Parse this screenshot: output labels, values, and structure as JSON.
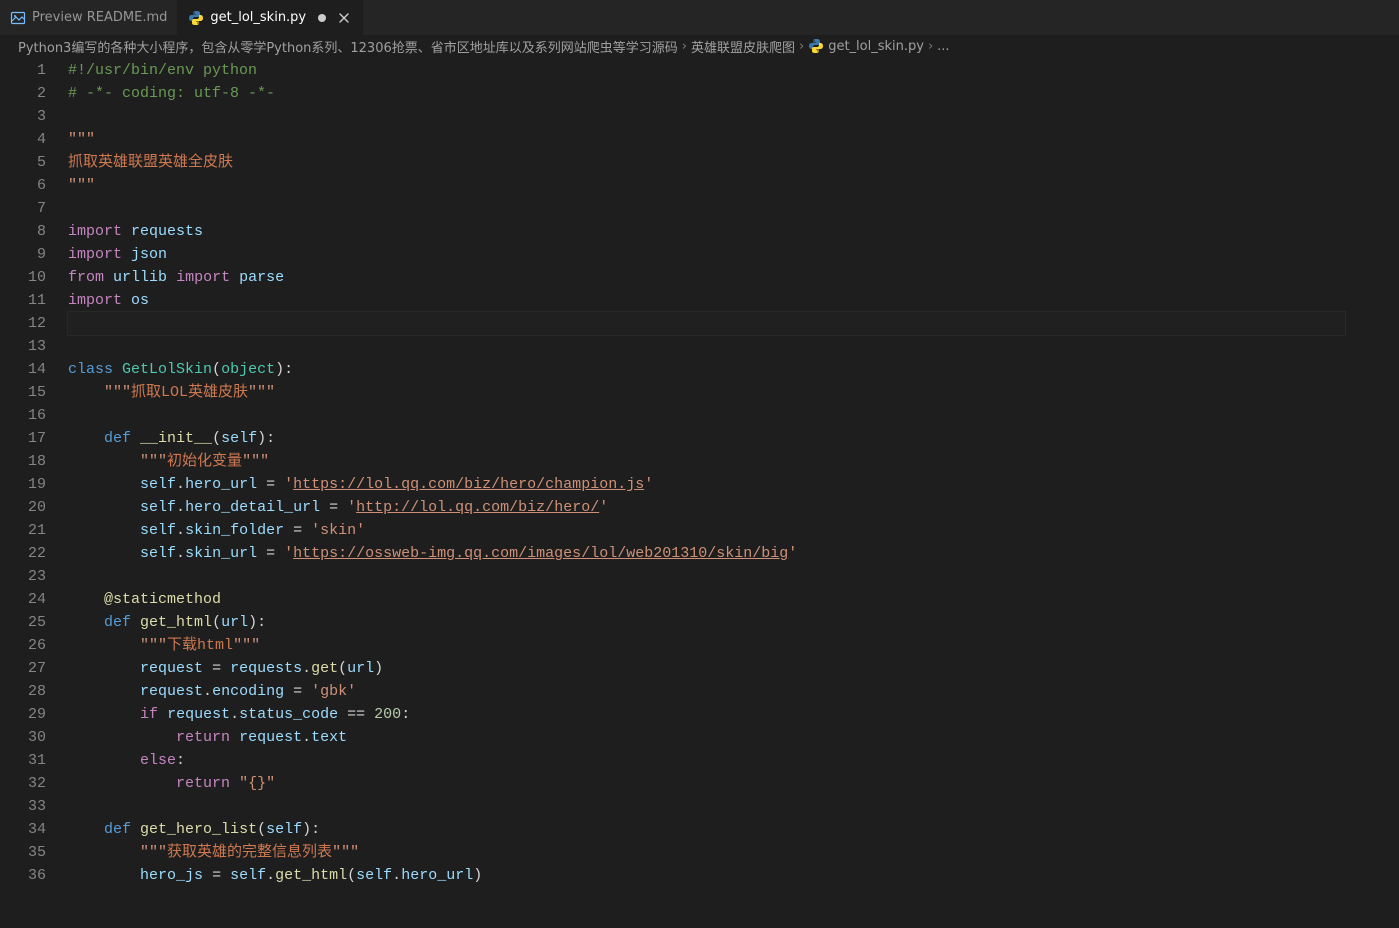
{
  "tabs": [
    {
      "label": "Preview README.md",
      "active": false,
      "dirty": false,
      "icon": "preview"
    },
    {
      "label": "get_lol_skin.py",
      "active": true,
      "dirty": true,
      "icon": "python"
    }
  ],
  "breadcrumbs": {
    "path_label": "Python3编写的各种大小程序，包含从零学Python系列、12306抢票、省市区地址库以及系列网站爬虫等学习源码",
    "folder": "英雄联盟皮肤爬图",
    "file": "get_lol_skin.py",
    "trailing": "..."
  },
  "editor": {
    "line_start": 1,
    "line_count": 36,
    "cursor_line": 12,
    "lines": [
      [
        [
          "comment",
          "#!/usr/bin/env python"
        ]
      ],
      [
        [
          "comment",
          "# -*- coding: utf-8 -*-"
        ]
      ],
      [],
      [
        [
          "docstr",
          "\"\"\""
        ]
      ],
      [
        [
          "docstr-cjk",
          "抓取英雄联盟英雄全皮肤"
        ]
      ],
      [
        [
          "docstr",
          "\"\"\""
        ]
      ],
      [],
      [
        [
          "keyword2",
          "import"
        ],
        [
          "default",
          " "
        ],
        [
          "var",
          "requests"
        ]
      ],
      [
        [
          "keyword2",
          "import"
        ],
        [
          "default",
          " "
        ],
        [
          "var",
          "json"
        ]
      ],
      [
        [
          "keyword2",
          "from"
        ],
        [
          "default",
          " "
        ],
        [
          "var",
          "urllib"
        ],
        [
          "default",
          " "
        ],
        [
          "keyword2",
          "import"
        ],
        [
          "default",
          " "
        ],
        [
          "var",
          "parse"
        ]
      ],
      [
        [
          "keyword2",
          "import"
        ],
        [
          "default",
          " "
        ],
        [
          "var",
          "os"
        ]
      ],
      [],
      [],
      [
        [
          "keyword",
          "class"
        ],
        [
          "default",
          " "
        ],
        [
          "class",
          "GetLolSkin"
        ],
        [
          "delim",
          "("
        ],
        [
          "builtin",
          "object"
        ],
        [
          "delim",
          ")"
        ],
        [
          "delim",
          ":"
        ]
      ],
      [
        [
          "ind",
          1
        ],
        [
          "docstr",
          "\"\"\""
        ],
        [
          "docstr-cjk",
          "抓取LOL英雄皮肤"
        ],
        [
          "docstr",
          "\"\"\""
        ]
      ],
      [],
      [
        [
          "ind",
          1
        ],
        [
          "keyword",
          "def"
        ],
        [
          "default",
          " "
        ],
        [
          "func",
          "__init__"
        ],
        [
          "delim",
          "("
        ],
        [
          "param",
          "self"
        ],
        [
          "delim",
          ")"
        ],
        [
          "delim",
          ":"
        ]
      ],
      [
        [
          "ind",
          2
        ],
        [
          "docstr",
          "\"\"\""
        ],
        [
          "docstr-cjk",
          "初始化变量"
        ],
        [
          "docstr",
          "\"\"\""
        ]
      ],
      [
        [
          "ind",
          2
        ],
        [
          "param",
          "self"
        ],
        [
          "default",
          "."
        ],
        [
          "var",
          "hero_url"
        ],
        [
          "default",
          " "
        ],
        [
          "op",
          "="
        ],
        [
          "default",
          " "
        ],
        [
          "string",
          "'"
        ],
        [
          "link",
          "https://lol.qq.com/biz/hero/champion.js"
        ],
        [
          "string",
          "'"
        ]
      ],
      [
        [
          "ind",
          2
        ],
        [
          "param",
          "self"
        ],
        [
          "default",
          "."
        ],
        [
          "var",
          "hero_detail_url"
        ],
        [
          "default",
          " "
        ],
        [
          "op",
          "="
        ],
        [
          "default",
          " "
        ],
        [
          "string",
          "'"
        ],
        [
          "link",
          "http://lol.qq.com/biz/hero/"
        ],
        [
          "string",
          "'"
        ]
      ],
      [
        [
          "ind",
          2
        ],
        [
          "param",
          "self"
        ],
        [
          "default",
          "."
        ],
        [
          "var",
          "skin_folder"
        ],
        [
          "default",
          " "
        ],
        [
          "op",
          "="
        ],
        [
          "default",
          " "
        ],
        [
          "string",
          "'skin'"
        ]
      ],
      [
        [
          "ind",
          2
        ],
        [
          "param",
          "self"
        ],
        [
          "default",
          "."
        ],
        [
          "var",
          "skin_url"
        ],
        [
          "default",
          " "
        ],
        [
          "op",
          "="
        ],
        [
          "default",
          " "
        ],
        [
          "string",
          "'"
        ],
        [
          "link",
          "https://ossweb-img.qq.com/images/lol/web201310/skin/big"
        ],
        [
          "string",
          "'"
        ]
      ],
      [],
      [
        [
          "ind",
          1
        ],
        [
          "func",
          "@staticmethod"
        ]
      ],
      [
        [
          "ind",
          1
        ],
        [
          "keyword",
          "def"
        ],
        [
          "default",
          " "
        ],
        [
          "func",
          "get_html"
        ],
        [
          "delim",
          "("
        ],
        [
          "param",
          "url"
        ],
        [
          "delim",
          ")"
        ],
        [
          "delim",
          ":"
        ]
      ],
      [
        [
          "ind",
          2
        ],
        [
          "docstr",
          "\"\"\""
        ],
        [
          "docstr-cjk",
          "下载html"
        ],
        [
          "docstr",
          "\"\"\""
        ]
      ],
      [
        [
          "ind",
          2
        ],
        [
          "var",
          "request"
        ],
        [
          "default",
          " "
        ],
        [
          "op",
          "="
        ],
        [
          "default",
          " "
        ],
        [
          "var",
          "requests"
        ],
        [
          "default",
          "."
        ],
        [
          "func",
          "get"
        ],
        [
          "delim",
          "("
        ],
        [
          "var",
          "url"
        ],
        [
          "delim",
          ")"
        ]
      ],
      [
        [
          "ind",
          2
        ],
        [
          "var",
          "request"
        ],
        [
          "default",
          "."
        ],
        [
          "var",
          "encoding"
        ],
        [
          "default",
          " "
        ],
        [
          "op",
          "="
        ],
        [
          "default",
          " "
        ],
        [
          "string",
          "'gbk'"
        ]
      ],
      [
        [
          "ind",
          2
        ],
        [
          "keyword2",
          "if"
        ],
        [
          "default",
          " "
        ],
        [
          "var",
          "request"
        ],
        [
          "default",
          "."
        ],
        [
          "var",
          "status_code"
        ],
        [
          "default",
          " "
        ],
        [
          "op",
          "=="
        ],
        [
          "default",
          " "
        ],
        [
          "number",
          "200"
        ],
        [
          "delim",
          ":"
        ]
      ],
      [
        [
          "ind",
          3
        ],
        [
          "keyword2",
          "return"
        ],
        [
          "default",
          " "
        ],
        [
          "var",
          "request"
        ],
        [
          "default",
          "."
        ],
        [
          "var",
          "text"
        ]
      ],
      [
        [
          "ind",
          2
        ],
        [
          "keyword2",
          "else"
        ],
        [
          "delim",
          ":"
        ]
      ],
      [
        [
          "ind",
          3
        ],
        [
          "keyword2",
          "return"
        ],
        [
          "default",
          " "
        ],
        [
          "string",
          "\"{}\""
        ]
      ],
      [],
      [
        [
          "ind",
          1
        ],
        [
          "keyword",
          "def"
        ],
        [
          "default",
          " "
        ],
        [
          "func",
          "get_hero_list"
        ],
        [
          "delim",
          "("
        ],
        [
          "param",
          "self"
        ],
        [
          "delim",
          ")"
        ],
        [
          "delim",
          ":"
        ]
      ],
      [
        [
          "ind",
          2
        ],
        [
          "docstr",
          "\"\"\""
        ],
        [
          "docstr-cjk",
          "获取英雄的完整信息列表"
        ],
        [
          "docstr",
          "\"\"\""
        ]
      ],
      [
        [
          "ind",
          2
        ],
        [
          "var",
          "hero_js"
        ],
        [
          "default",
          " "
        ],
        [
          "op",
          "="
        ],
        [
          "default",
          " "
        ],
        [
          "param",
          "self"
        ],
        [
          "default",
          "."
        ],
        [
          "func",
          "get_html"
        ],
        [
          "delim",
          "("
        ],
        [
          "param",
          "self"
        ],
        [
          "default",
          "."
        ],
        [
          "var",
          "hero_url"
        ],
        [
          "delim",
          ")"
        ]
      ]
    ]
  }
}
